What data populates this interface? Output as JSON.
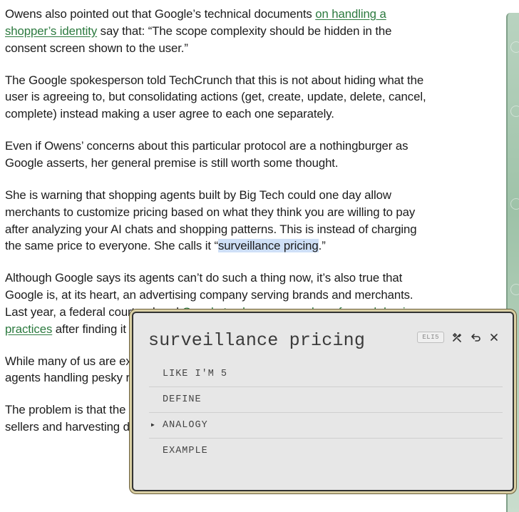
{
  "article": {
    "p1_pre": "Owens also pointed out that Google’s technical documents ",
    "p1_link": "on handling a shopper’s identity",
    "p1_post": " say that: “The scope complexity should be hidden in the consent screen shown to the user.”",
    "p2": "The Google spokesperson told TechCrunch that this is not about hiding what the user is agreeing to, but consolidating actions (get, create, update, delete, cancel, complete) instead making a user agree to each one separately.",
    "p3": "Even if Owens’ concerns about this particular protocol are a nothingburger as Google asserts, her general premise is still worth some thought.",
    "p4_pre": "She is warning that shopping agents built by Big Tech could one day allow merchants to customize pricing based on what they think you are willing to pay after analyzing your AI chats and shopping patterns. This is instead of charging the same price to everyone. She calls it “",
    "p4_hl": "surveillance pricing",
    "p4_post": ".”",
    "p5_pre": "Although Google says its agents can’t do such a thing now, it’s also true that Google is, at its heart, an advertising company serving brands and merchants. Last year, a federal court ordered ",
    "p5_link": "Google to change a number of search business practices",
    "p5_post": " after finding it guilty of anticompetitive behavior.",
    "p6": "While many of us are excited by the prospect of AI agents handling pesky tasks, agents handling pesky researching replacements, kinds of abuse that will",
    "p7": "The problem is that the build agentic shopping business rests on serving the sellers and harvesting data on consumers."
  },
  "popup": {
    "title": "surveillance pricing",
    "badge": "ELI5",
    "items": [
      {
        "label": "LIKE I'M 5"
      },
      {
        "label": "DEFINE"
      },
      {
        "label": "ANALOGY"
      },
      {
        "label": "EXAMPLE"
      }
    ]
  }
}
